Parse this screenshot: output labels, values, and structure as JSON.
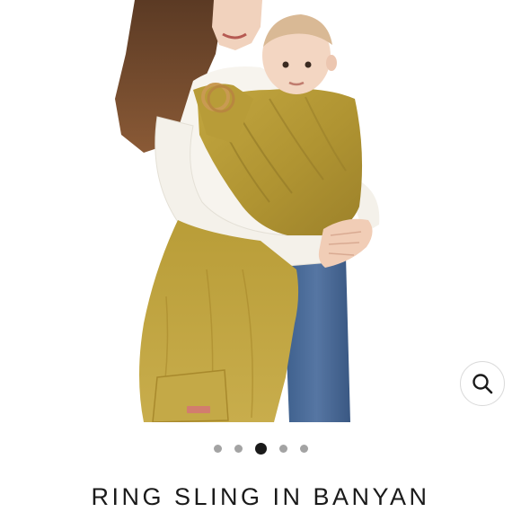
{
  "product": {
    "title": "RING SLING IN BANYAN",
    "image_alt": "Woman wearing a mustard linen ring sling holding a baby"
  },
  "gallery": {
    "slide_count": 5,
    "active_index": 2
  },
  "zoom": {
    "icon": "magnifier-icon"
  },
  "colors": {
    "sling": "#b59a35",
    "active_dot": "#1a1a1a",
    "inactive_dot": "#a3a3a3"
  }
}
